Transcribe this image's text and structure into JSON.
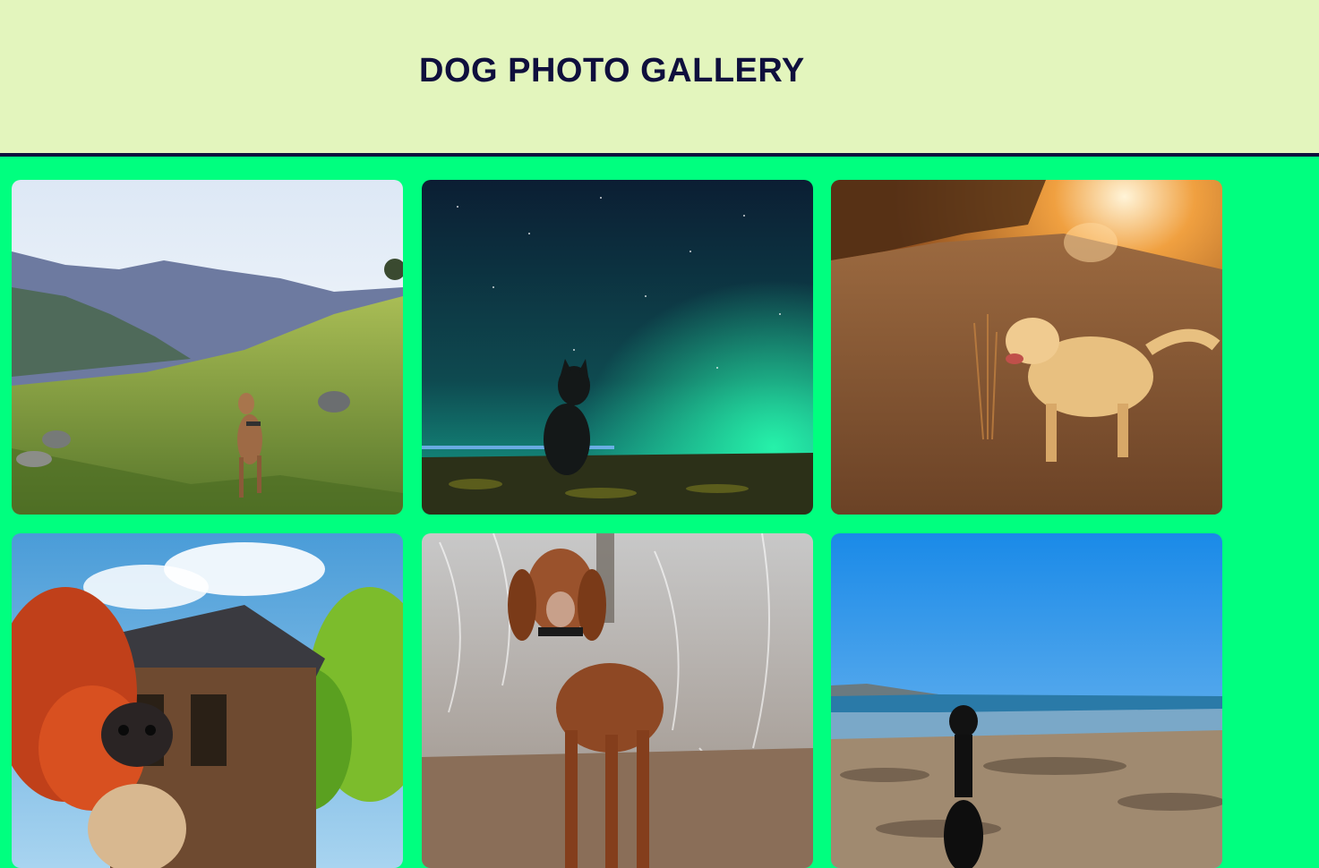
{
  "header": {
    "title": "DOG PHOTO GALLERY",
    "background": "#e3f5bd",
    "title_color": "#0f0f3d"
  },
  "gallery": {
    "background": "#00ff7f",
    "photos": [
      {
        "name": "photo-dog-mountain-meadow"
      },
      {
        "name": "photo-dog-night-sky"
      },
      {
        "name": "photo-golden-retriever-sunset"
      },
      {
        "name": "photo-pug-temple"
      },
      {
        "name": "photo-vizsla-frost"
      },
      {
        "name": "photo-dog-beach"
      }
    ]
  }
}
